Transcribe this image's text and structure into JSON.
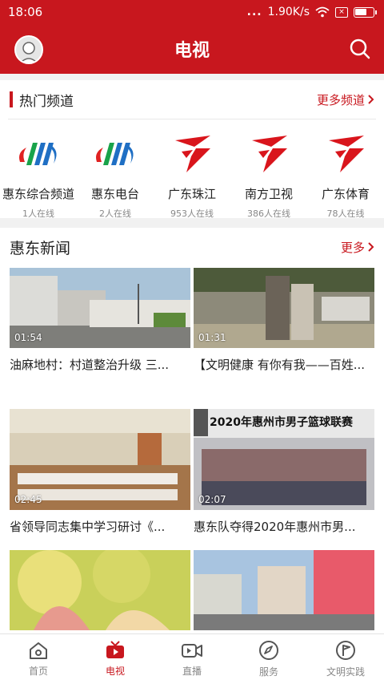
{
  "status_bar": {
    "time": "18:06",
    "dots": "...",
    "speed": "1.90K/s"
  },
  "header": {
    "title": "电视"
  },
  "hot_channels": {
    "title": "热门频道",
    "more_label": "更多频道",
    "items": [
      {
        "name": "惠东综合频道",
        "online": "1人在线",
        "logo": "huidong-logo"
      },
      {
        "name": "惠东电台",
        "online": "2人在线",
        "logo": "huidong-logo"
      },
      {
        "name": "广东珠江",
        "online": "953人在线",
        "logo": "gdtv-logo"
      },
      {
        "name": "南方卫视",
        "online": "386人在线",
        "logo": "gdtv-logo"
      },
      {
        "name": "广东体育",
        "online": "78人在线",
        "logo": "gdtv-logo"
      }
    ]
  },
  "news": {
    "title": "惠东新闻",
    "more_label": "更多",
    "items": [
      {
        "title": "油麻地村：村道整治升级 三...",
        "duration": "01:54"
      },
      {
        "title": "【文明健康 有你有我——百姓...",
        "duration": "01:31"
      },
      {
        "title": "省领导同志集中学习研讨《...",
        "duration": "02:45"
      },
      {
        "title": "惠东队夺得2020年惠州市男...",
        "duration": "02:07",
        "banner": "2020年惠州市男子篮球联赛"
      },
      {
        "title": "",
        "duration": ""
      },
      {
        "title": "",
        "duration": ""
      }
    ]
  },
  "tabs": [
    {
      "label": "首页",
      "icon": "home-icon",
      "active": false
    },
    {
      "label": "电视",
      "icon": "tv-icon",
      "active": true
    },
    {
      "label": "直播",
      "icon": "video-camera-icon",
      "active": false
    },
    {
      "label": "服务",
      "icon": "compass-icon",
      "active": false
    },
    {
      "label": "文明实践",
      "icon": "flag-icon",
      "active": false
    }
  ],
  "colors": {
    "brand_red": "#c8171e"
  }
}
